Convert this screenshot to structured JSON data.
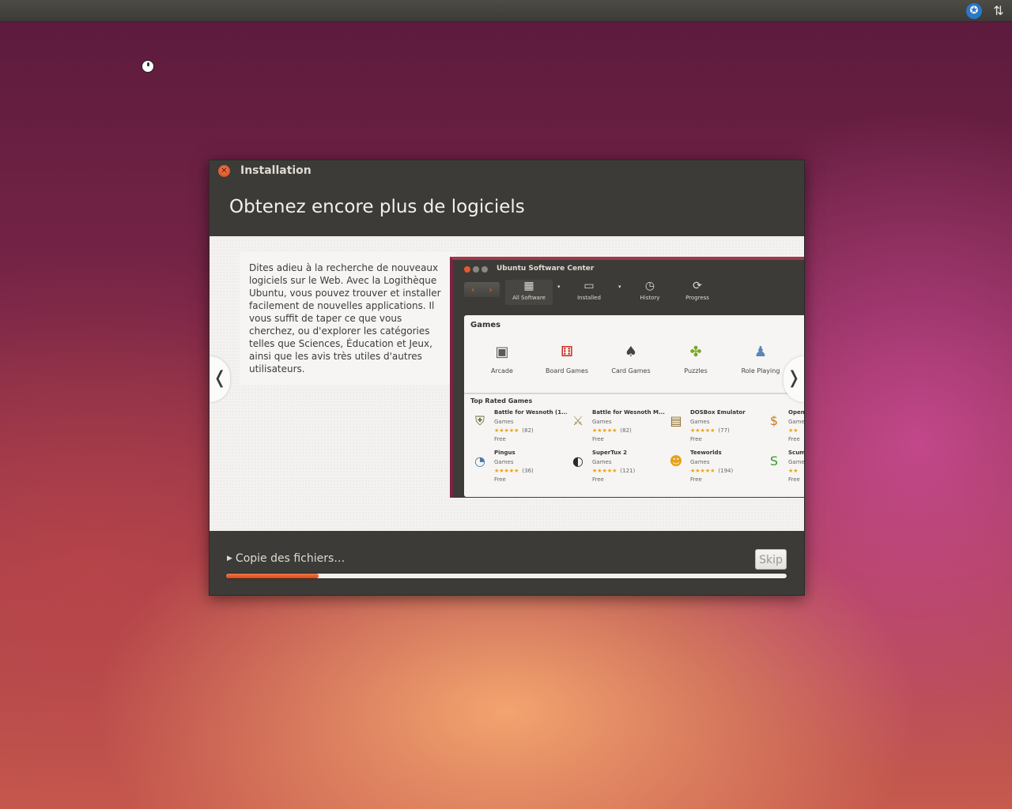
{
  "panel": {
    "accessibility_icon": "accessibility-icon",
    "network_icon": "network-updown-icon"
  },
  "window": {
    "title": "Installation",
    "heading": "Obtenez encore plus de logiciels",
    "slide": {
      "text": "Dites adieu à la recherche de nouveaux logiciels sur le Web. Avec la Logithèque Ubuntu, vous pouvez trouver et installer facilement de nouvelles applications. Il vous suffit de taper ce que vous cherchez, ou d'explorer les catégories telles que Sciences, Éducation et Jeux, ainsi que les avis très utiles d'autres utilisateurs.",
      "prev": "❬",
      "next": "❭",
      "usc": {
        "title": "Ubuntu Software Center",
        "toolbar": [
          {
            "label": "All Software",
            "icon": "▦"
          },
          {
            "label": "Installed",
            "icon": "▭"
          },
          {
            "label": "History",
            "icon": "◷"
          },
          {
            "label": "Progress",
            "icon": "⟳"
          }
        ],
        "section_title": "Games",
        "categories": [
          {
            "label": "Arcade",
            "icon": "▣",
            "color": "#5a5a5a"
          },
          {
            "label": "Board Games",
            "icon": "⚅",
            "color": "#c8281e"
          },
          {
            "label": "Card Games",
            "icon": "♠",
            "color": "#444444"
          },
          {
            "label": "Puzzles",
            "icon": "✤",
            "color": "#7aa72a"
          },
          {
            "label": "Role Playing",
            "icon": "♟",
            "color": "#5a86b8"
          }
        ],
        "top_rated_title": "Top Rated Games",
        "apps": [
          {
            "name": "Battle for Wesnoth (1...",
            "category": "Games",
            "stars": "★★★★★",
            "count": "(82)",
            "price": "Free",
            "icon": "⛨",
            "color": "#6a6a3a"
          },
          {
            "name": "Battle for Wesnoth M...",
            "category": "Games",
            "stars": "★★★★★",
            "count": "(82)",
            "price": "Free",
            "icon": "⚔",
            "color": "#a08a5a"
          },
          {
            "name": "DOSBox Emulator",
            "category": "Games",
            "stars": "★★★★★",
            "count": "(77)",
            "price": "Free",
            "icon": "▤",
            "color": "#8a6a2a"
          },
          {
            "name": "OpenT",
            "category": "Game",
            "stars": "★★",
            "count": "",
            "price": "Free",
            "icon": "$",
            "color": "#c87a1a"
          },
          {
            "name": "Pingus",
            "category": "Games",
            "stars": "★★★★★",
            "count": "(36)",
            "price": "Free",
            "icon": "◔",
            "color": "#4a7aa8"
          },
          {
            "name": "SuperTux 2",
            "category": "Games",
            "stars": "★★★★★",
            "count": "(121)",
            "price": "Free",
            "icon": "◐",
            "color": "#2a2a2a"
          },
          {
            "name": "Teeworlds",
            "category": "Games",
            "stars": "★★★★★",
            "count": "(194)",
            "price": "Free",
            "icon": "☻",
            "color": "#e8a21a"
          },
          {
            "name": "Scum",
            "category": "Game",
            "stars": "★★",
            "count": "",
            "price": "Free",
            "icon": "S",
            "color": "#3a9a2a"
          }
        ]
      }
    },
    "status": "Copie des fichiers…",
    "skip_label": "Skip",
    "progress_fraction": 0.165
  }
}
